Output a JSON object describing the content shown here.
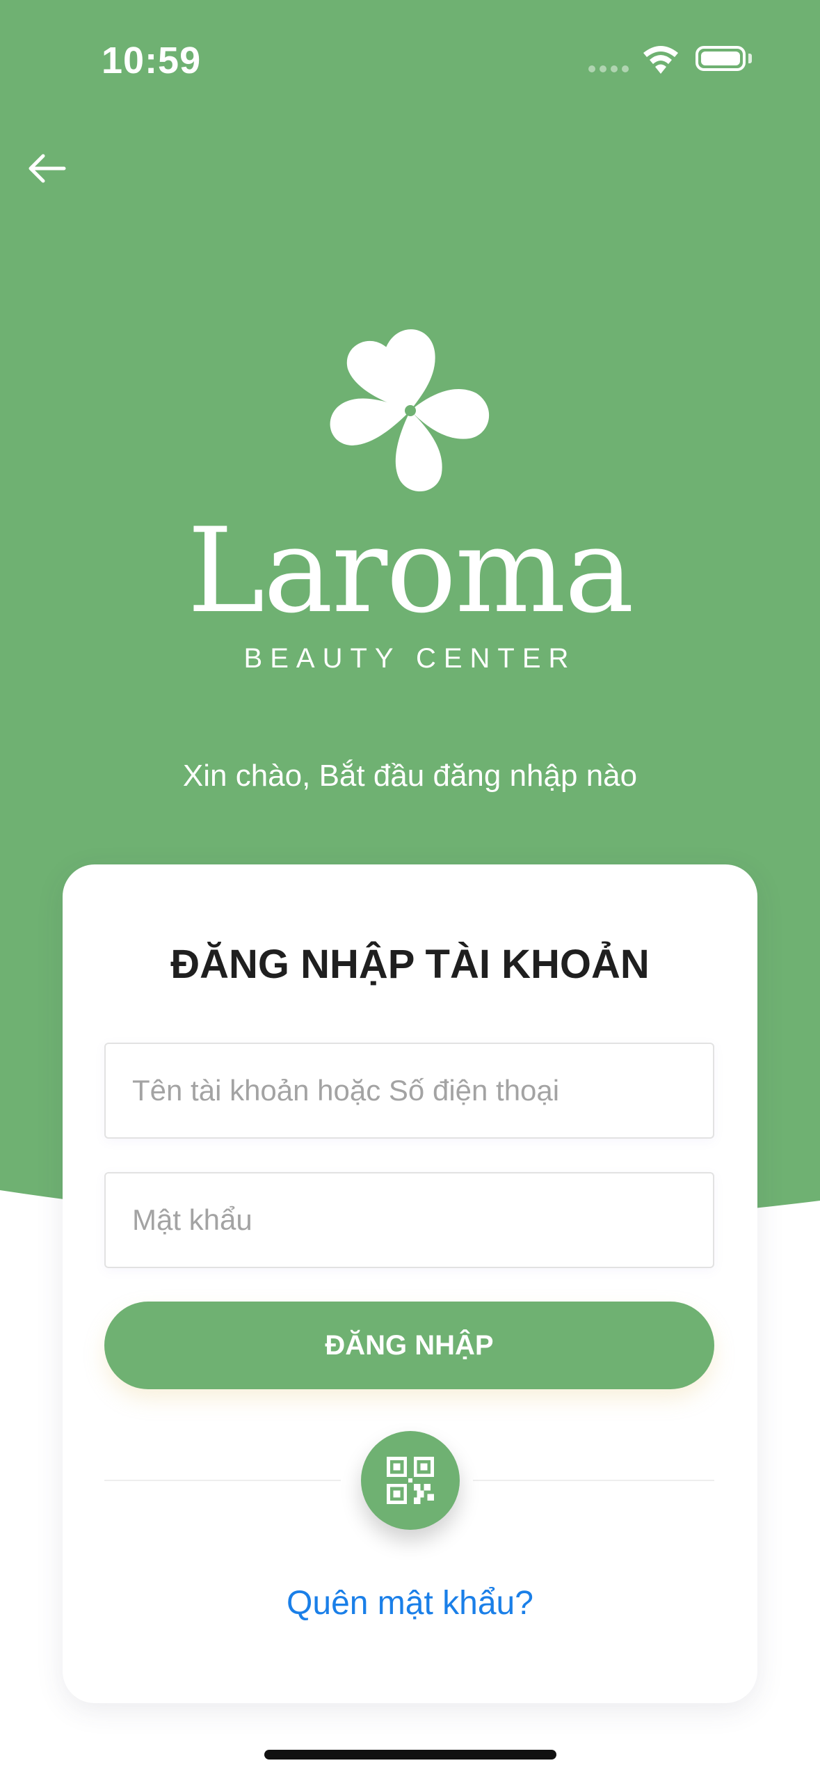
{
  "status_bar": {
    "time": "10:59"
  },
  "brand": {
    "name": "Laroma",
    "subtitle": "BEAUTY CENTER"
  },
  "greeting": "Xin chào, Bắt đầu đăng nhập nào",
  "login_card": {
    "title": "ĐĂNG NHẬP TÀI KHOẢN",
    "username_placeholder": "Tên tài khoản hoặc Số điện thoại",
    "username_value": "",
    "password_placeholder": "Mật khẩu",
    "password_value": "",
    "login_button_label": "ĐĂNG NHẬP",
    "qr_icon": "qr-code-icon",
    "forgot_password_label": "Quên mật khẩu?"
  },
  "colors": {
    "brand_green": "#6fb172",
    "link_blue": "#1a7fe8",
    "title_text": "#1f1f1f"
  }
}
